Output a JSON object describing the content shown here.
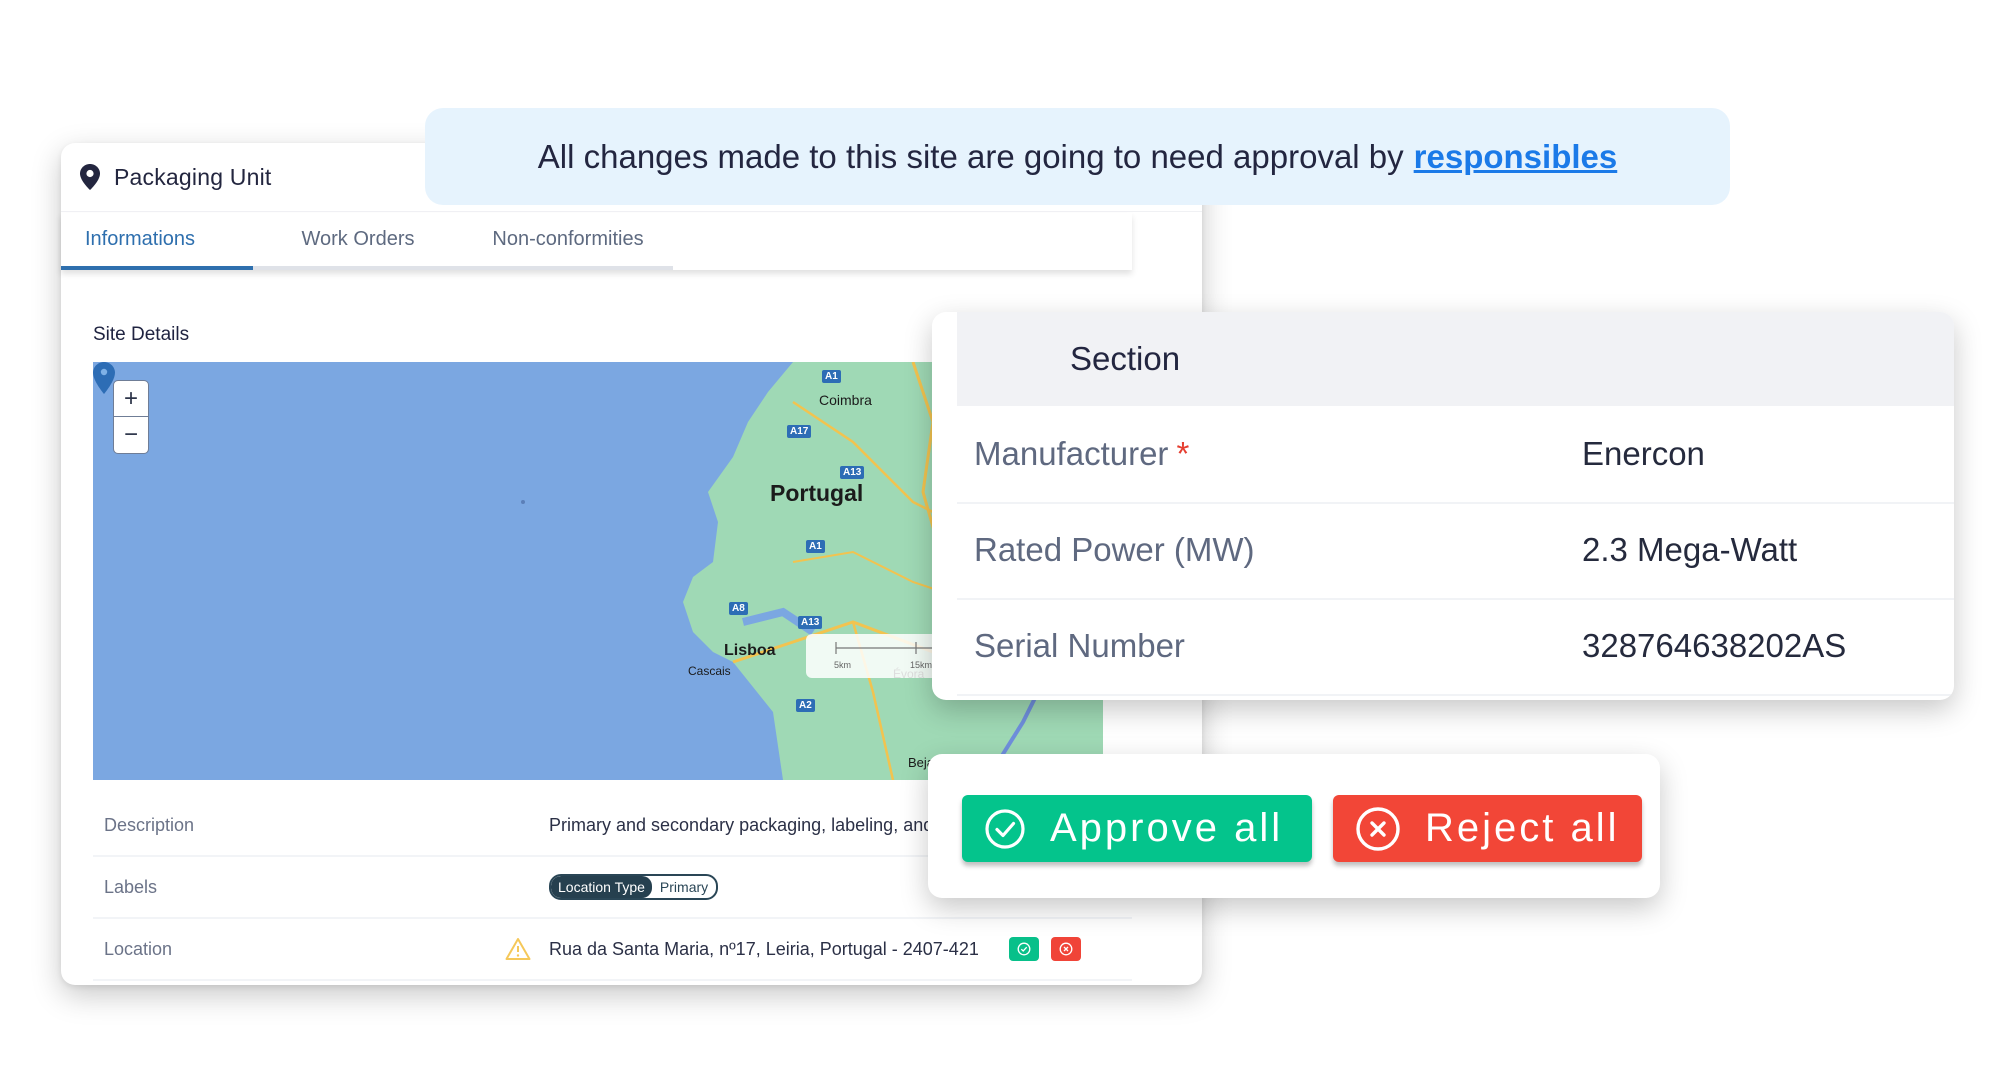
{
  "banner": {
    "text": "All changes made to this site are going to need approval by",
    "link": "responsibles",
    "background": "#e6f3fd",
    "link_color": "#1b7ae8"
  },
  "site_card": {
    "title": "Packaging Unit",
    "title_icon": "map-pin-icon",
    "tabs": [
      {
        "label": "Informations",
        "active": true
      },
      {
        "label": "Work Orders",
        "active": false
      },
      {
        "label": "Non-conformities",
        "active": false
      }
    ],
    "section_label": "Site Details",
    "map": {
      "zoom_in": "+",
      "zoom_out": "−",
      "labels": {
        "country": "Portugal",
        "city1": "Coimbra",
        "city2": "Lisboa",
        "city3": "Cascais",
        "city4": "Évora",
        "city5": "Beja"
      },
      "roads": [
        "A1",
        "A17",
        "A13",
        "A1",
        "A8",
        "A13",
        "A2"
      ],
      "scale": [
        "5km",
        "15km"
      ]
    },
    "rows": [
      {
        "label": "Description",
        "value": "Primary and secondary packaging, labeling, and"
      },
      {
        "label": "Labels",
        "chip_key": "Location Type",
        "chip_value": "Primary"
      },
      {
        "label": "Location",
        "value": "Rua da Santa Maria, nº17, Leiria, Portugal - 2407-421",
        "warning_icon": "warning-icon"
      }
    ]
  },
  "section_card": {
    "title": "Section",
    "rows": [
      {
        "label": "Manufacturer",
        "required": "*",
        "value": "Enercon"
      },
      {
        "label": "Rated Power (MW)",
        "value": "2.3 Mega-Watt"
      },
      {
        "label": "Serial Number",
        "value": "328764638202AS"
      }
    ]
  },
  "actions": {
    "approve_label": "Approve all",
    "reject_label": "Reject all",
    "approve_color": "#04c48c",
    "reject_color": "#f24637"
  }
}
